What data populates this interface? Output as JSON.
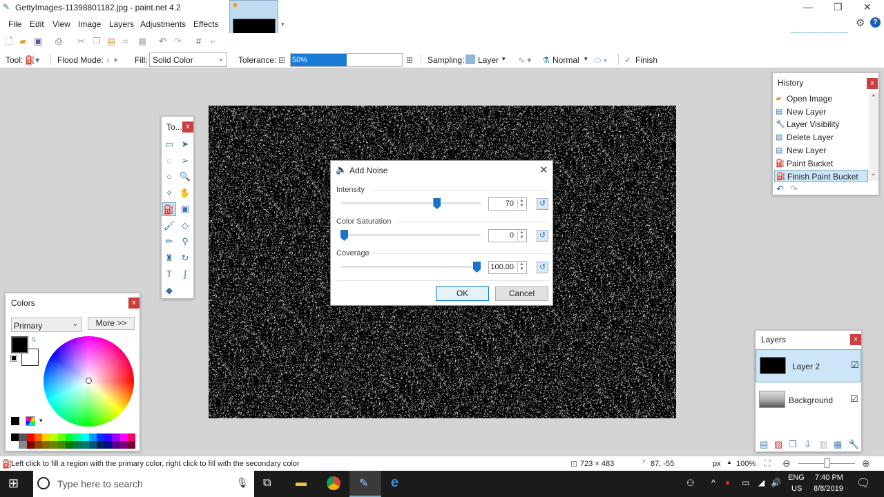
{
  "window": {
    "title": "GettyImages-11398801182.jpg - paint.net 4.2"
  },
  "menu": [
    "File",
    "Edit",
    "View",
    "Image",
    "Layers",
    "Adjustments",
    "Effects"
  ],
  "toolbar": {
    "tool_label": "Tool:",
    "flood_mode_label": "Flood Mode:",
    "fill_label": "Fill:",
    "fill_value": "Solid Color",
    "tolerance_label": "Tolerance:",
    "tolerance_value": "50%",
    "tolerance_percent": 50,
    "sampling_label": "Sampling:",
    "sampling_value": "Layer",
    "blend_mode": "Normal",
    "finish_label": "Finish"
  },
  "toolbox": {
    "title": "To..."
  },
  "dialog": {
    "title": "Add Noise",
    "intensity": {
      "label": "Intensity",
      "value": "70",
      "fraction": 0.7
    },
    "saturation": {
      "label": "Color Saturation",
      "value": "0",
      "fraction": 0.0
    },
    "coverage": {
      "label": "Coverage",
      "value": "100.00",
      "fraction": 1.0
    },
    "ok": "OK",
    "cancel": "Cancel"
  },
  "history": {
    "title": "History",
    "items": [
      {
        "label": "Open Image",
        "icon": "folder-icon"
      },
      {
        "label": "New Layer",
        "icon": "new-layer-icon"
      },
      {
        "label": "Layer Visibility",
        "icon": "wrench-icon"
      },
      {
        "label": "Delete Layer",
        "icon": "delete-layer-icon"
      },
      {
        "label": "New Layer",
        "icon": "new-layer-icon"
      },
      {
        "label": "Paint Bucket",
        "icon": "paint-bucket-icon"
      },
      {
        "label": "Finish Paint Bucket",
        "icon": "paint-bucket-icon",
        "selected": true
      }
    ]
  },
  "colors": {
    "title": "Colors",
    "mode": "Primary",
    "more": "More >>",
    "primary": "#000000",
    "secondary": "#ffffff"
  },
  "layers": {
    "title": "Layers",
    "items": [
      {
        "name": "Layer 2",
        "visible": true,
        "selected": true
      },
      {
        "name": "Background",
        "visible": true
      }
    ]
  },
  "status": {
    "hint": "Left click to fill a region with the primary color, right click to fill with the secondary color",
    "size": "723 × 483",
    "cursor": "87, -55",
    "unit": "px",
    "zoom": "100%"
  },
  "taskbar": {
    "search_placeholder": "Type here to search",
    "lang1": "ENG",
    "lang2": "US",
    "time": "7:40 PM",
    "date": "8/8/2019"
  },
  "accent": "#1a73c9"
}
